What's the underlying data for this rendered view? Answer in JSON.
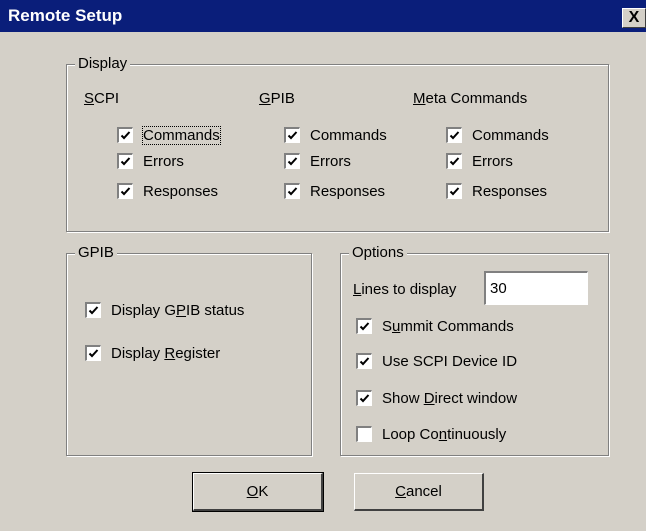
{
  "window": {
    "title": "Remote Setup",
    "close_glyph": "X"
  },
  "display": {
    "legend": "Display",
    "columns": [
      {
        "header": "SCPI",
        "items": [
          {
            "label": "Commands",
            "checked": true
          },
          {
            "label": "Errors",
            "checked": true
          },
          {
            "label": "Responses",
            "checked": true
          }
        ]
      },
      {
        "header": "GPIB",
        "items": [
          {
            "label": "Commands",
            "checked": true
          },
          {
            "label": "Errors",
            "checked": true
          },
          {
            "label": "Responses",
            "checked": true
          }
        ]
      },
      {
        "header": "Meta Commands",
        "items": [
          {
            "label": "Commands",
            "checked": true
          },
          {
            "label": "Errors",
            "checked": true
          },
          {
            "label": "Responses",
            "checked": true
          }
        ]
      }
    ]
  },
  "gpib": {
    "legend": "GPIB",
    "items": [
      {
        "label": "Display GPIB status",
        "checked": true
      },
      {
        "label": "Display Register",
        "checked": true
      }
    ]
  },
  "options": {
    "legend": "Options",
    "lines_label": "Lines to display",
    "lines_value": "30",
    "items": [
      {
        "label": "Summit Commands",
        "checked": true
      },
      {
        "label": "Use SCPI Device ID",
        "checked": true
      },
      {
        "label": "Show Direct window",
        "checked": true
      },
      {
        "label": "Loop Continuously",
        "checked": false
      }
    ]
  },
  "buttons": {
    "ok": "OK",
    "cancel": "Cancel"
  },
  "colors": {
    "titlebar": "#0a1e7a",
    "face": "#d4d0c8"
  }
}
